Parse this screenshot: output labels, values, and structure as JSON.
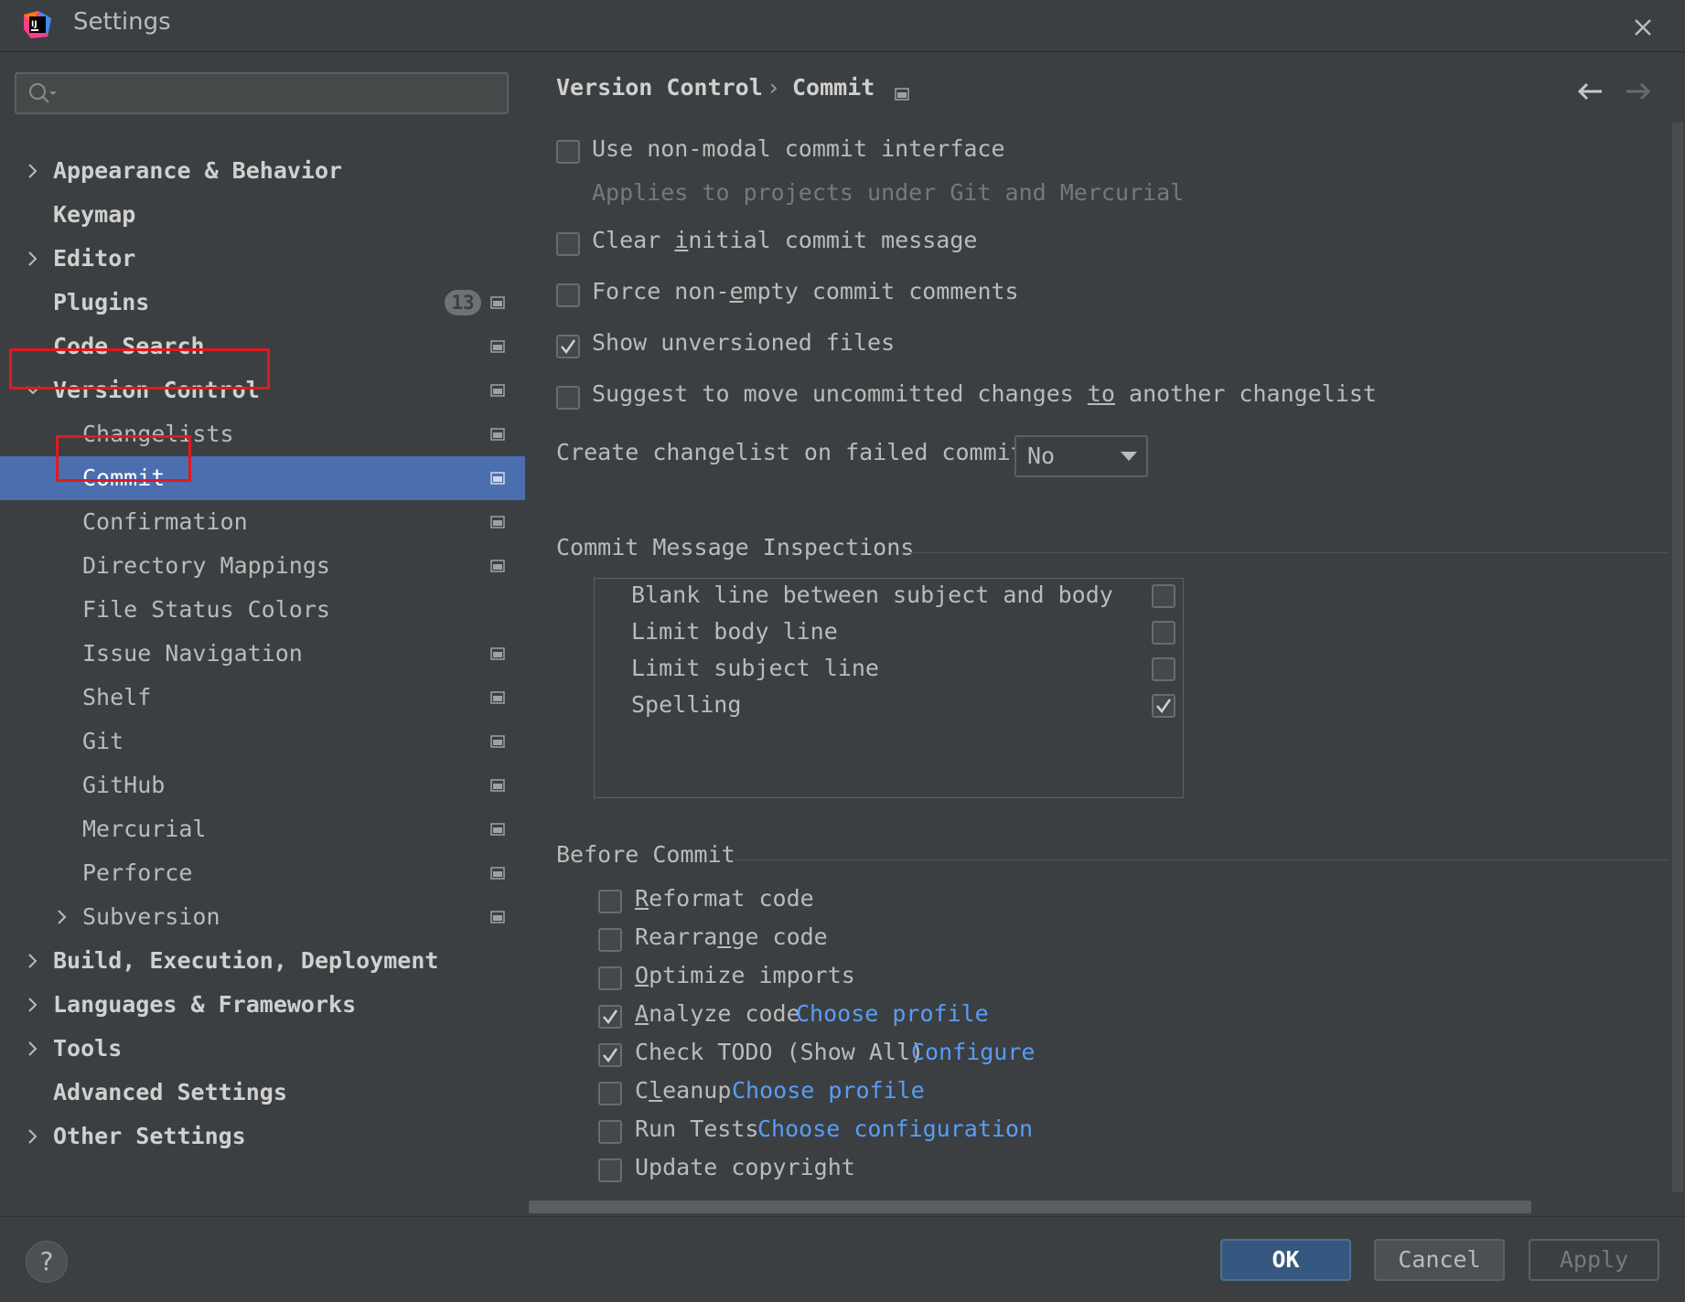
{
  "window": {
    "title": "Settings"
  },
  "search": {
    "placeholder": ""
  },
  "sidebar": {
    "items": [
      {
        "label": "Appearance & Behavior"
      },
      {
        "label": "Keymap"
      },
      {
        "label": "Editor"
      },
      {
        "label": "Plugins",
        "badge": "13"
      },
      {
        "label": "Code Search"
      },
      {
        "label": "Version Control"
      },
      {
        "label": "Changelists"
      },
      {
        "label": "Commit"
      },
      {
        "label": "Confirmation"
      },
      {
        "label": "Directory Mappings"
      },
      {
        "label": "File Status Colors"
      },
      {
        "label": "Issue Navigation"
      },
      {
        "label": "Shelf"
      },
      {
        "label": "Git"
      },
      {
        "label": "GitHub"
      },
      {
        "label": "Mercurial"
      },
      {
        "label": "Perforce"
      },
      {
        "label": "Subversion"
      },
      {
        "label": "Build, Execution, Deployment"
      },
      {
        "label": "Languages & Frameworks"
      },
      {
        "label": "Tools"
      },
      {
        "label": "Advanced Settings"
      },
      {
        "label": "Other Settings"
      }
    ]
  },
  "breadcrumb": {
    "parent": "Version Control",
    "separator": "›",
    "current": "Commit"
  },
  "options": {
    "non_modal": {
      "label": "Use non-modal commit interface",
      "checked": false
    },
    "non_modal_hint": "Applies to projects under Git and Mercurial",
    "clear_initial": {
      "pre": "Clear ",
      "u": "i",
      "post": "nitial commit message",
      "checked": false
    },
    "force_nonempty": {
      "pre": "Force non-",
      "u": "e",
      "post": "mpty commit comments",
      "checked": false
    },
    "show_unversioned": {
      "label": "Show unversioned files",
      "checked": true
    },
    "suggest_move": {
      "pre": "Suggest to move uncommitted changes ",
      "u": "to",
      "post": " another changelist",
      "checked": false
    }
  },
  "changelist": {
    "label": "Create changelist on failed commit:",
    "value": "No"
  },
  "inspections": {
    "title": "Commit Message Inspections",
    "items": [
      {
        "label": "Blank line between subject and body",
        "checked": false
      },
      {
        "label": "Limit body line",
        "checked": false
      },
      {
        "label": "Limit subject line",
        "checked": false
      },
      {
        "label": "Spelling",
        "checked": true
      }
    ]
  },
  "before_commit": {
    "title": "Before Commit",
    "items": [
      {
        "u": "R",
        "label": "eformat code",
        "checked": false,
        "link": ""
      },
      {
        "pre": "Rearra",
        "u": "n",
        "label": "ge code",
        "checked": false,
        "link": ""
      },
      {
        "u": "O",
        "label": "ptimize imports",
        "checked": false,
        "link": ""
      },
      {
        "u": "A",
        "label": "nalyze code",
        "checked": true,
        "link": "Choose profile"
      },
      {
        "label": "Check TODO (Show All)",
        "checked": true,
        "link": "Configure"
      },
      {
        "pre": "C",
        "u": "l",
        "label": "eanup",
        "checked": false,
        "link": "Choose profile"
      },
      {
        "label": "Run Tests",
        "checked": false,
        "link": "Choose configuration"
      },
      {
        "label": "Update copyright",
        "checked": false,
        "link": ""
      }
    ]
  },
  "buttons": {
    "help": "?",
    "ok": "OK",
    "cancel": "Cancel",
    "apply": "Apply"
  },
  "colors": {
    "background": "#3c3f41",
    "selection": "#4b6eaf",
    "link": "#589df6",
    "highlight": "#e3191c"
  }
}
